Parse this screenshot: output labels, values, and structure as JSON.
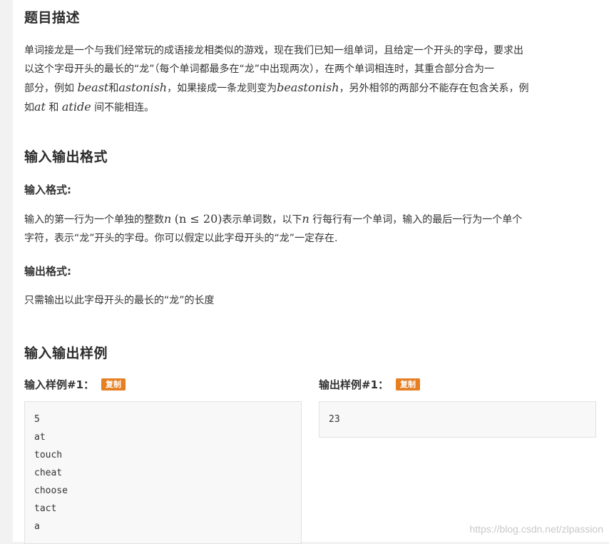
{
  "sections": {
    "description_title": "题目描述",
    "description": {
      "l1": "单词接龙是一个与我们经常玩的成语接龙相类似的游戏，现在我们已知一组单词，且给定一个开头的字母，要求出",
      "l2": "以这个字母开头的最长的“龙”（每个单词都最多在“龙”中出现两次），在两个单词相连时，其重合部分合为一",
      "l3_a": "部分，例如 ",
      "l3_m1": "beast",
      "l3_b": "和",
      "l3_m2": "astonish",
      "l3_c": "，如果接成一条龙则变为",
      "l3_m3": "beastonish",
      "l3_d": "，另外相邻的两部分不能存在包含关系，例",
      "l4_a": "如",
      "l4_m1": "at",
      "l4_b": " 和 ",
      "l4_m2": "atide",
      "l4_c": " 间不能相连。"
    },
    "io_title": "输入输出格式",
    "input_format_title": "输入格式:",
    "input_format": {
      "l1_a": "输入的第一行为一个单独的整数",
      "l1_m1": "n",
      "l1_m2": "(n ≤ 20)",
      "l1_b": "表示单词数，以下",
      "l1_m3": "n",
      "l1_c": " 行每行有一个单词，输入的最后一行为一个单个",
      "l2": "字符，表示“龙”开头的字母。你可以假定以此字母开头的“龙”一定存在."
    },
    "output_format_title": "输出格式:",
    "output_format": "只需输出以此字母开头的最长的“龙”的长度",
    "samples_title": "输入输出样例",
    "sample_input_title": "输入样例#1：",
    "sample_output_title": "输出样例#1：",
    "copy_label": "复制",
    "sample_input_lines": [
      "5",
      "at",
      "touch",
      "cheat",
      "choose",
      "tact",
      "a"
    ],
    "sample_output_lines": [
      "23"
    ]
  },
  "watermark": "https://blog.csdn.net/zlpassion",
  "colors": {
    "copy_button": "#e67e22",
    "page_bg": "#f2f2f2",
    "card_bg": "#ffffff"
  }
}
